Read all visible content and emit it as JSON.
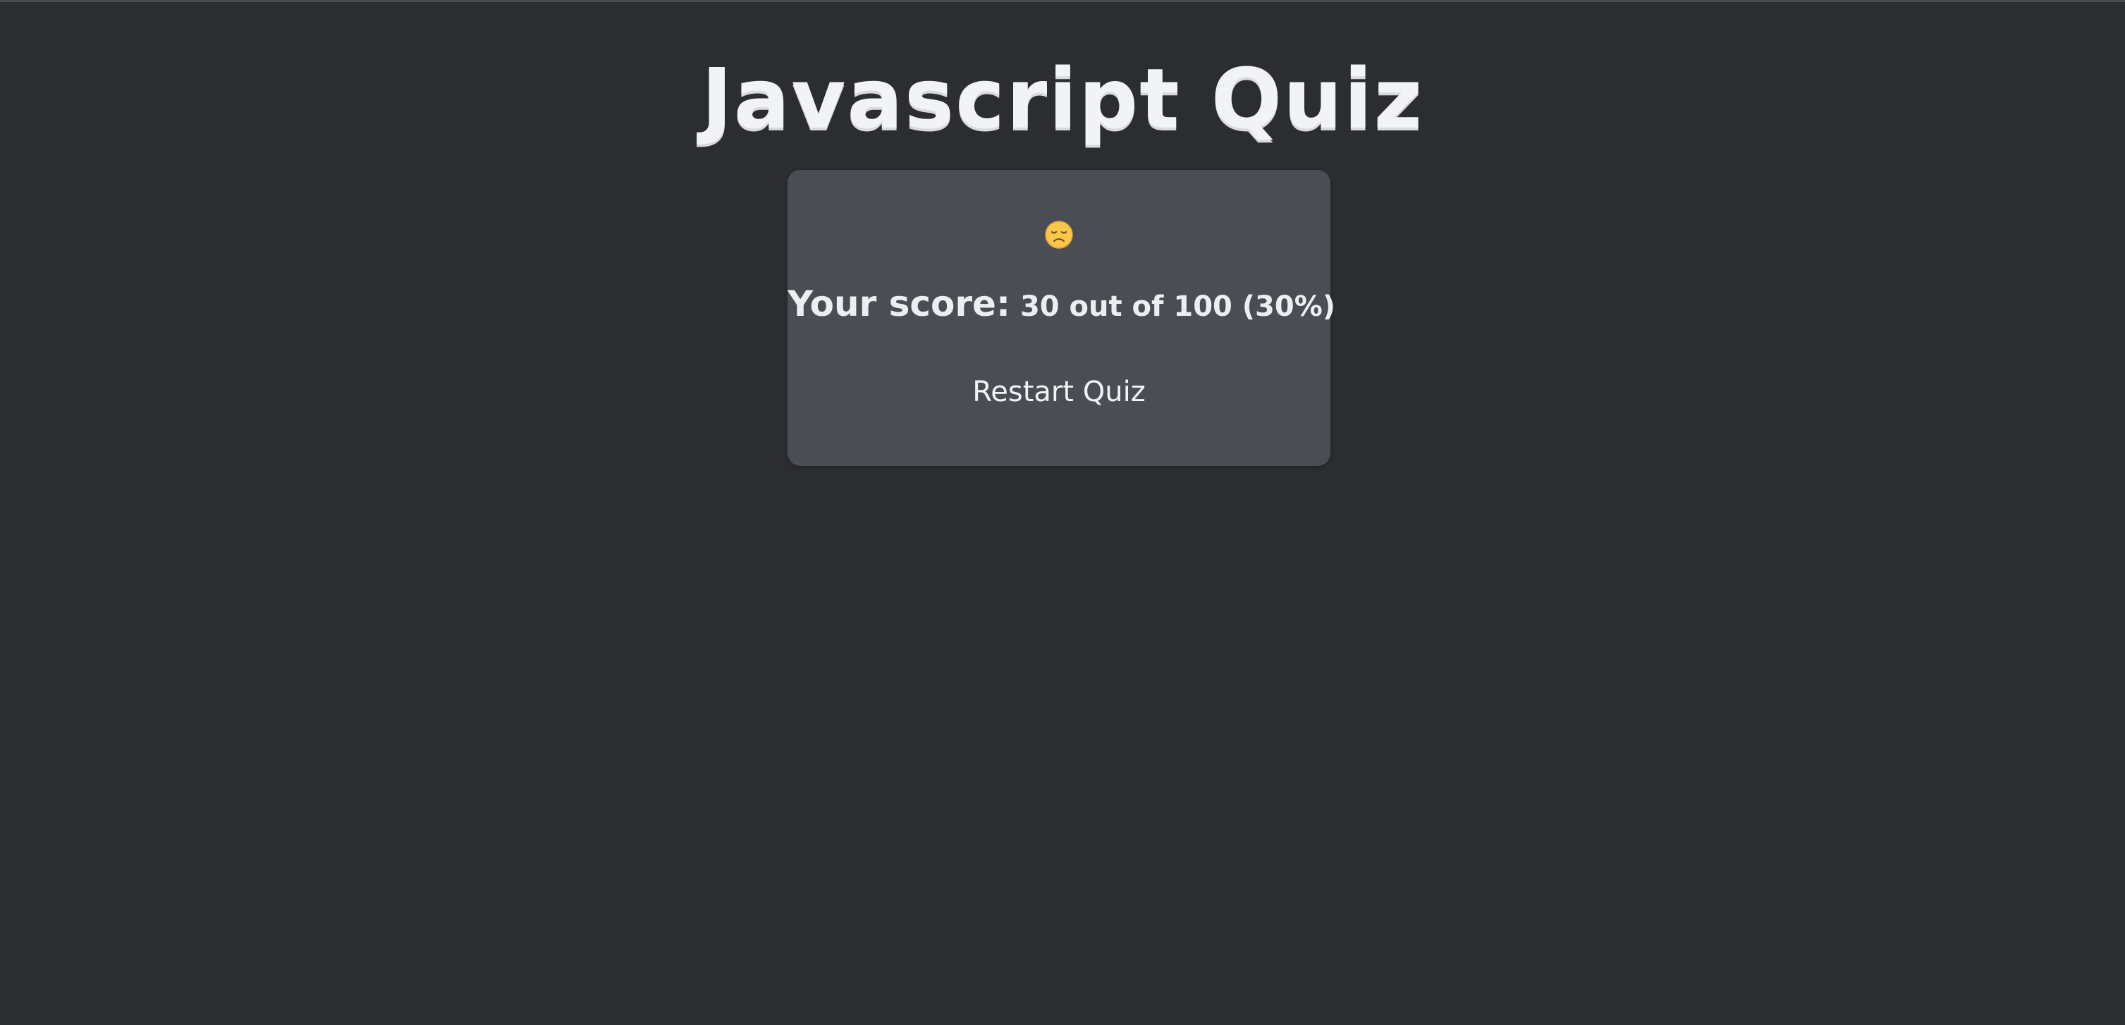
{
  "header": {
    "title": "Javascript Quiz"
  },
  "result": {
    "emoji_icon": "disappointed-face-icon",
    "score_label": "Your score:",
    "score_value": "30 out of 100 (30%)",
    "restart_label": "Restart Quiz"
  },
  "colors": {
    "background": "#2c2d31",
    "card": "#4a4d54",
    "text": "#eceef1"
  }
}
